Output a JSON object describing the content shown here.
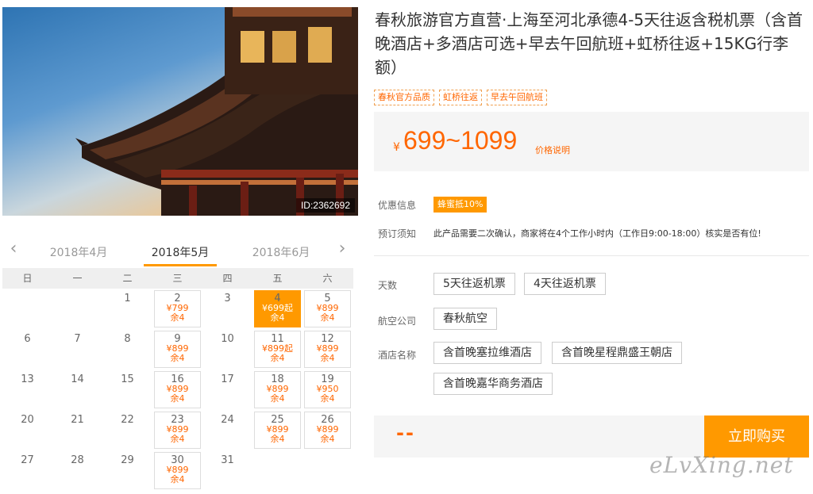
{
  "hero": {
    "id_label": "ID:2362692"
  },
  "calendar": {
    "prev_month": "2018年4月",
    "current_month": "2018年5月",
    "next_month": "2018年6月",
    "weekdays": [
      "日",
      "一",
      "二",
      "三",
      "四",
      "五",
      "六"
    ],
    "days": [
      {
        "d": "",
        "col": 1
      },
      {
        "d": "",
        "col": 2
      },
      {
        "d": "1"
      },
      {
        "d": "2",
        "price": "¥799",
        "left": "余4"
      },
      {
        "d": "3"
      },
      {
        "d": "4",
        "price": "¥699起",
        "left": "余4",
        "selected": true
      },
      {
        "d": "5",
        "price": "¥899",
        "left": "余4"
      },
      {
        "d": "6"
      },
      {
        "d": "7"
      },
      {
        "d": "8"
      },
      {
        "d": "9",
        "price": "¥899",
        "left": "余4"
      },
      {
        "d": "10"
      },
      {
        "d": "11",
        "price": "¥899起",
        "left": "余4"
      },
      {
        "d": "12",
        "price": "¥899",
        "left": "余4"
      },
      {
        "d": "13"
      },
      {
        "d": "14"
      },
      {
        "d": "15"
      },
      {
        "d": "16",
        "price": "¥899",
        "left": "余4"
      },
      {
        "d": "17"
      },
      {
        "d": "18",
        "price": "¥899",
        "left": "余4"
      },
      {
        "d": "19",
        "price": "¥950",
        "left": "余4"
      },
      {
        "d": "20"
      },
      {
        "d": "21"
      },
      {
        "d": "22"
      },
      {
        "d": "23",
        "price": "¥899",
        "left": "余4"
      },
      {
        "d": "24"
      },
      {
        "d": "25",
        "price": "¥899",
        "left": "余4"
      },
      {
        "d": "26",
        "price": "¥899",
        "left": "余4"
      },
      {
        "d": "27"
      },
      {
        "d": "28"
      },
      {
        "d": "29"
      },
      {
        "d": "30",
        "price": "¥899",
        "left": "余4"
      },
      {
        "d": "31"
      }
    ]
  },
  "product": {
    "title": "春秋旅游官方直营·上海至河北承德4-5天往返含税机票（含首晚酒店+多酒店可选+早去午回航班+虹桥往返+15KG行李额）",
    "tags": [
      "春秋官方品质",
      "虹桥往返",
      "早去午回航班"
    ],
    "price_currency": "¥",
    "price_range": "699~1099",
    "price_note": "价格说明",
    "promo_label": "优惠信息",
    "promo_badge": "蜂蜜抵10%",
    "booking_label": "预订须知",
    "booking_note": "此产品需要二次确认，商家将在4个工作小时内（工作日9:00-18:00）核实是否有位!",
    "days_label": "天数",
    "days_options": [
      "5天往返机票",
      "4天往返机票"
    ],
    "airline_label": "航空公司",
    "airline_options": [
      "春秋航空"
    ],
    "hotel_label": "酒店名称",
    "hotel_options": [
      "含首晚塞拉维酒店",
      "含首晚星程鼎盛王朝店",
      "含首晚嘉华商务酒店"
    ],
    "total_placeholder": "--",
    "buy_label": "立即购买"
  },
  "watermark": "eLvXing.net",
  "colors": {
    "accent": "#ff9900",
    "price": "#ff6600"
  }
}
